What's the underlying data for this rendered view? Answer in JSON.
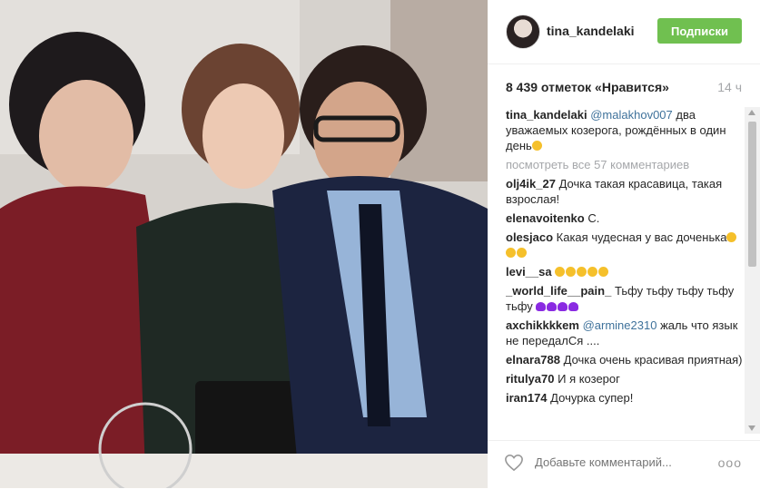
{
  "post": {
    "username": "tina_kandelaki",
    "follow_label": "Подписки",
    "likes_text": "8 439 отметок «Нравится»",
    "time": "14 ч",
    "caption": {
      "user": "tina_kandelaki",
      "mention": "@malakhov007",
      "text": "два уважаемых козерога, рождённых в один день"
    },
    "view_all": "посмотреть все 57 комментариев",
    "comments": [
      {
        "user": "olj4ik_27",
        "text": "Дочка такая красавица, такая взрослая!"
      },
      {
        "user": "elenavoitenko",
        "text": "С."
      },
      {
        "user": "olesjaco",
        "text": "Какая чудесная у вас доченька"
      },
      {
        "user": "levi__sa",
        "text": ""
      },
      {
        "user": "_world_life__pain_",
        "text": "Тьфу тьфу тьфу тьфу тьфу"
      },
      {
        "user": "axchikkkkem",
        "mention": "@armine2310",
        "text": "жаль что язык не передалСя ...."
      },
      {
        "user": "elnara788",
        "text": "Дочка очень красивая приятная)"
      },
      {
        "user": "ritulya70",
        "text": "И я козерог"
      },
      {
        "user": "iran174",
        "text": "Дочурка супер!"
      }
    ],
    "add_comment_placeholder": "Добавьте комментарий...",
    "more_label": "ооо"
  }
}
